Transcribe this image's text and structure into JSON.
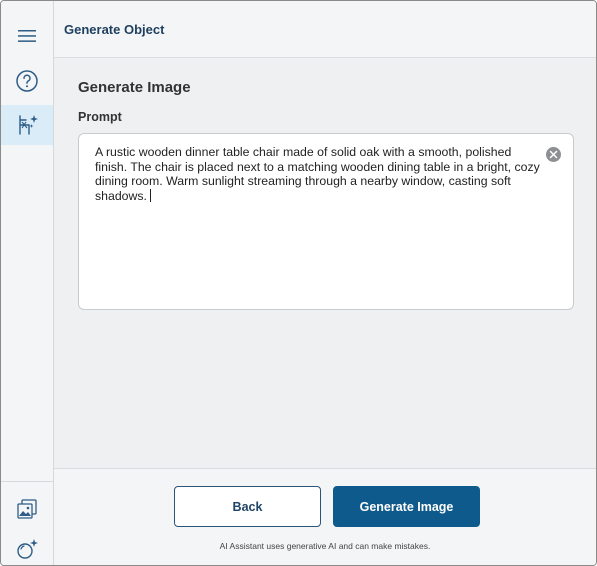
{
  "header": {
    "title": "Generate Object"
  },
  "main": {
    "section_title": "Generate Image",
    "prompt_label": "Prompt",
    "prompt_value": "A rustic wooden dinner table chair made of solid oak with a smooth, polished finish. The chair is placed next to a matching wooden dining table in a bright, cozy dining room. Warm sunlight streaming through a nearby window, casting soft shadows."
  },
  "footer": {
    "back_label": "Back",
    "generate_label": "Generate Image",
    "disclaimer": "AI Assistant uses generative AI and can make mistakes."
  },
  "icons": {
    "menu": "hamburger-menu-icon",
    "help": "help-icon",
    "generate_object": "sparkle-chair-icon",
    "gallery": "image-gallery-icon",
    "ai_object": "sparkle-sphere-icon",
    "clear": "clear-icon"
  },
  "colors": {
    "accent": "#0f5a8c",
    "active_rail": "#d9ecf8",
    "header_text": "#1f3f5e"
  }
}
